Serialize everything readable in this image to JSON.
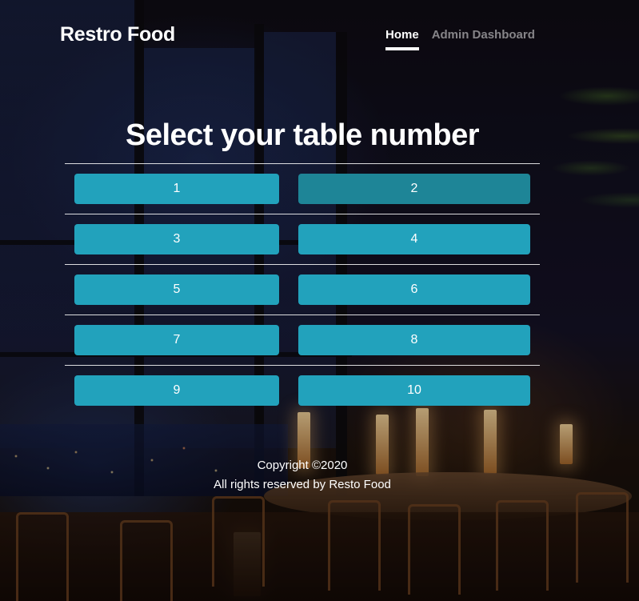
{
  "navbar": {
    "brand": "Restro Food",
    "links": [
      {
        "label": "Home",
        "active": true
      },
      {
        "label": "Admin Dashboard",
        "active": false
      }
    ]
  },
  "main": {
    "title": "Select your table number",
    "tables": [
      {
        "label": "1"
      },
      {
        "label": "2",
        "state": "hover"
      },
      {
        "label": "3"
      },
      {
        "label": "4"
      },
      {
        "label": "5"
      },
      {
        "label": "6"
      },
      {
        "label": "7"
      },
      {
        "label": "8"
      },
      {
        "label": "9"
      },
      {
        "label": "10"
      }
    ],
    "button_color": "#22a2bc",
    "button_hover_color": "#1e8597"
  },
  "footer": {
    "copyright": "Copyright ©2020",
    "rights": "All rights reserved by Resto Food"
  }
}
